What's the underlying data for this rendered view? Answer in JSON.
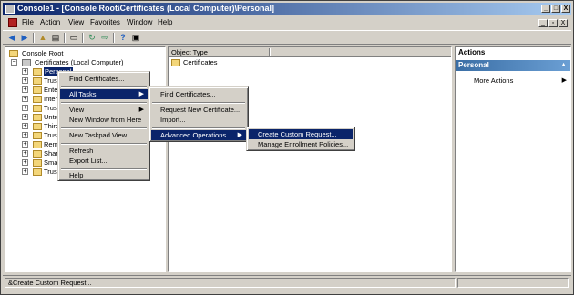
{
  "window": {
    "title": "Console1 - [Console Root\\Certificates (Local Computer)\\Personal]"
  },
  "title_buttons": [
    "_",
    "□",
    "X"
  ],
  "mdi_buttons": [
    "_",
    "▫",
    "X"
  ],
  "menu": [
    "File",
    "Action",
    "View",
    "Favorites",
    "Window",
    "Help"
  ],
  "toolbar_icons": [
    "back-icon",
    "forward-icon",
    "up-folder-icon",
    "show-tree-icon",
    "properties-icon",
    "refresh-icon",
    "export-icon",
    "help-icon",
    "console-icon"
  ],
  "tree": {
    "root": "Console Root",
    "certs": "Certificates (Local Computer)",
    "personal": "Personal",
    "children": [
      "Trust",
      "Enter",
      "Inter",
      "Trust",
      "Untru",
      "Third",
      "Trust",
      "Remo",
      "Share",
      "Smar",
      "Trust"
    ]
  },
  "content": {
    "column": "Object Type",
    "items": [
      "Certificates"
    ]
  },
  "actions": {
    "header": "Actions",
    "section": "Personal",
    "section_caret": "▲",
    "item": "More Actions",
    "item_arrow": "▶"
  },
  "context_menu": {
    "find": "Find Certificates...",
    "all_tasks": "All Tasks",
    "view": "View",
    "new_window": "New Window from Here",
    "new_taskpad": "New Taskpad View...",
    "refresh": "Refresh",
    "export": "Export List...",
    "help": "Help",
    "arrow": "▶"
  },
  "all_tasks_menu": {
    "find": "Find Certificates...",
    "request": "Request New Certificate...",
    "import": "Import...",
    "advanced": "Advanced Operations"
  },
  "advanced_menu": {
    "create": "Create Custom Request...",
    "manage": "Manage Enrollment Policies..."
  },
  "status": {
    "text": "&Create Custom Request..."
  }
}
